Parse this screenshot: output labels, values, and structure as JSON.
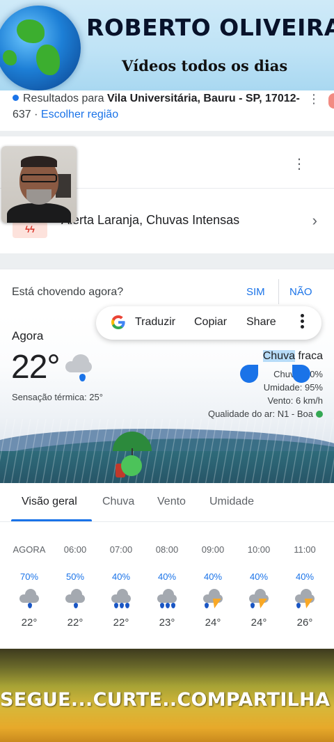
{
  "banner": {
    "title": "ROBERTO OLIVEIRA",
    "subtitle": "Vídeos todos os dias"
  },
  "results": {
    "prefix": "Resultados para ",
    "location": "Vila Universitária, Bauru - SP, 17012-",
    "zip_suffix": "637 · ",
    "change_region": "Escolher região"
  },
  "alert": {
    "icon_glyph": "ϟϟ",
    "text": "Alerta Laranja, Chuvas Intensas"
  },
  "question": {
    "text": "Está chovendo agora?",
    "yes": "SIM",
    "no": "NÃO"
  },
  "floating_menu": {
    "translate": "Traduzir",
    "copy": "Copiar",
    "share": "Share"
  },
  "weather": {
    "now_label": "Agora",
    "temperature": "22°",
    "feels_like": "Sensação térmica: 25°",
    "condition_highlight": "Chuva",
    "condition_rest": " fraca",
    "rain_chance": "Chuva: 90%",
    "humidity": "Umidade: 95%",
    "wind": "Vento: 6 km/h",
    "air_quality": "Qualidade do ar: N1 - Boa",
    "air_quality_color": "#34a853"
  },
  "tabs": [
    {
      "label": "Visão geral"
    },
    {
      "label": "Chuva"
    },
    {
      "label": "Vento"
    },
    {
      "label": "Umidade"
    }
  ],
  "hourly": [
    {
      "time": "AGORA",
      "precip": "70%",
      "icon": "cloud-rain-light-icon",
      "temp": "22°"
    },
    {
      "time": "06:00",
      "precip": "50%",
      "icon": "cloud-rain-light-icon",
      "temp": "22°"
    },
    {
      "time": "07:00",
      "precip": "40%",
      "icon": "cloud-rain-icon",
      "temp": "22°"
    },
    {
      "time": "08:00",
      "precip": "40%",
      "icon": "cloud-rain-icon",
      "temp": "23°"
    },
    {
      "time": "09:00",
      "precip": "40%",
      "icon": "thunderstorm-icon",
      "temp": "24°"
    },
    {
      "time": "10:00",
      "precip": "40%",
      "icon": "thunderstorm-icon",
      "temp": "24°"
    },
    {
      "time": "11:00",
      "precip": "40%",
      "icon": "thunderstorm-icon",
      "temp": "26°"
    }
  ],
  "footer": {
    "text": "SEGUE...CURTE..COMPARTILHA"
  },
  "colors": {
    "accent": "#1a73e8",
    "alert": "#d93025",
    "good": "#34a853"
  }
}
